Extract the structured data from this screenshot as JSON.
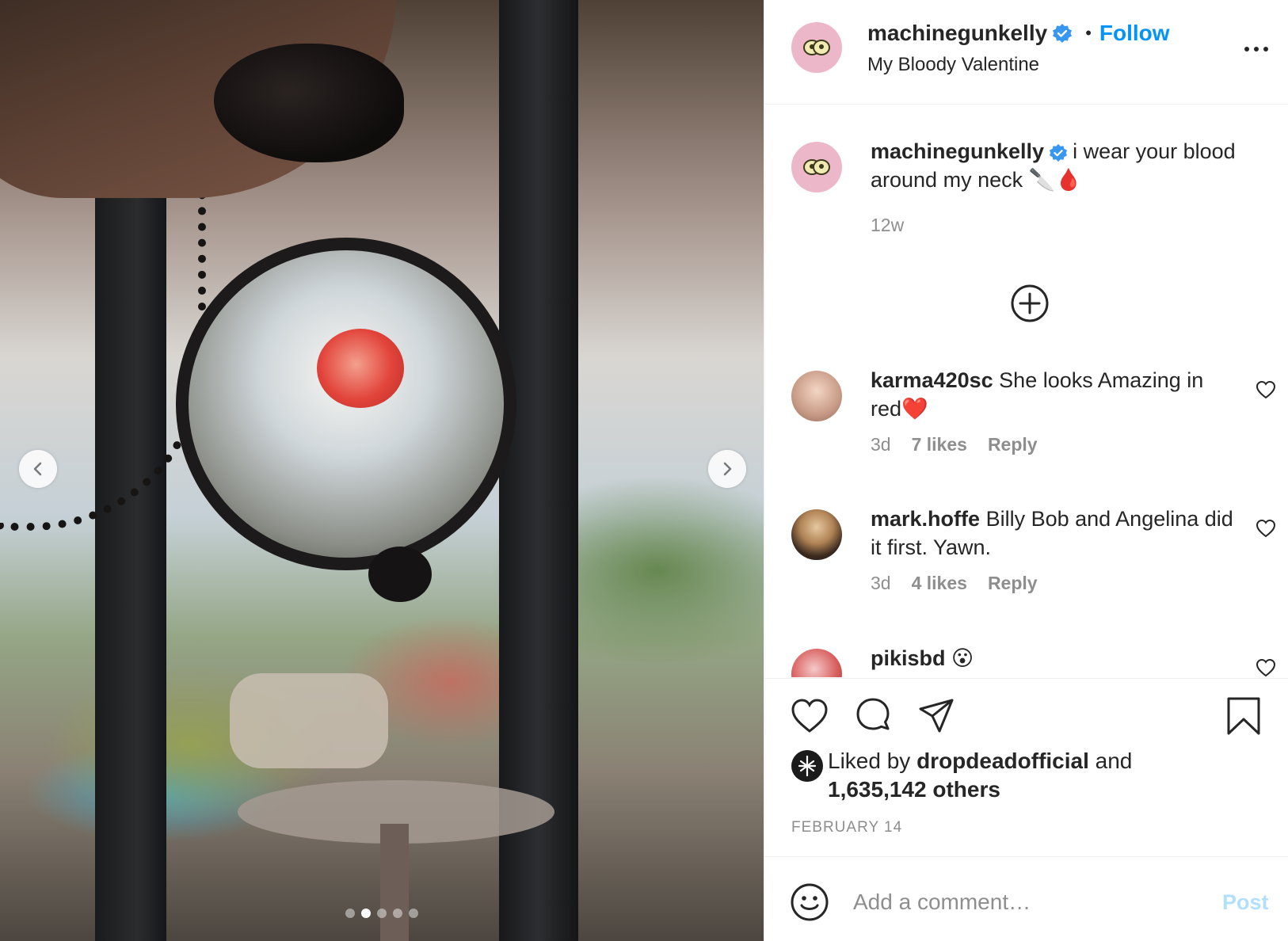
{
  "post": {
    "username": "machinegunkelly",
    "follow_label": "Follow",
    "separator": "•",
    "location": "My Bloody Valentine",
    "more_icon": "more-horizontal-icon"
  },
  "caption": {
    "username": "machinegunkelly",
    "text": "i wear your blood around my neck 🔪🩸",
    "time": "12w"
  },
  "load_more_icon": "plus-circle-icon",
  "comments": [
    {
      "username": "karma420sc",
      "text": "She looks Amazing in red❤️",
      "time": "3d",
      "likes": "7 likes",
      "reply": "Reply"
    },
    {
      "username": "mark.hoffe",
      "text": "Billy Bob and Angelina did it first. Yawn.",
      "time": "3d",
      "likes": "4 likes",
      "reply": "Reply"
    },
    {
      "username": "pikisbd",
      "text": "😮"
    }
  ],
  "likes": {
    "prefix": "Liked by",
    "liker": "dropdeadofficial",
    "conjunction": "and",
    "others": "1,635,142 others"
  },
  "date": "FEBRUARY 14",
  "comment_box": {
    "placeholder": "Add a comment…",
    "post_label": "Post"
  },
  "carousel": {
    "slides": 5,
    "active_index": 1
  },
  "colors": {
    "accent": "#0095f6",
    "post_disabled": "#b2dffc",
    "muted": "#8e8e8e",
    "text": "#262626"
  }
}
